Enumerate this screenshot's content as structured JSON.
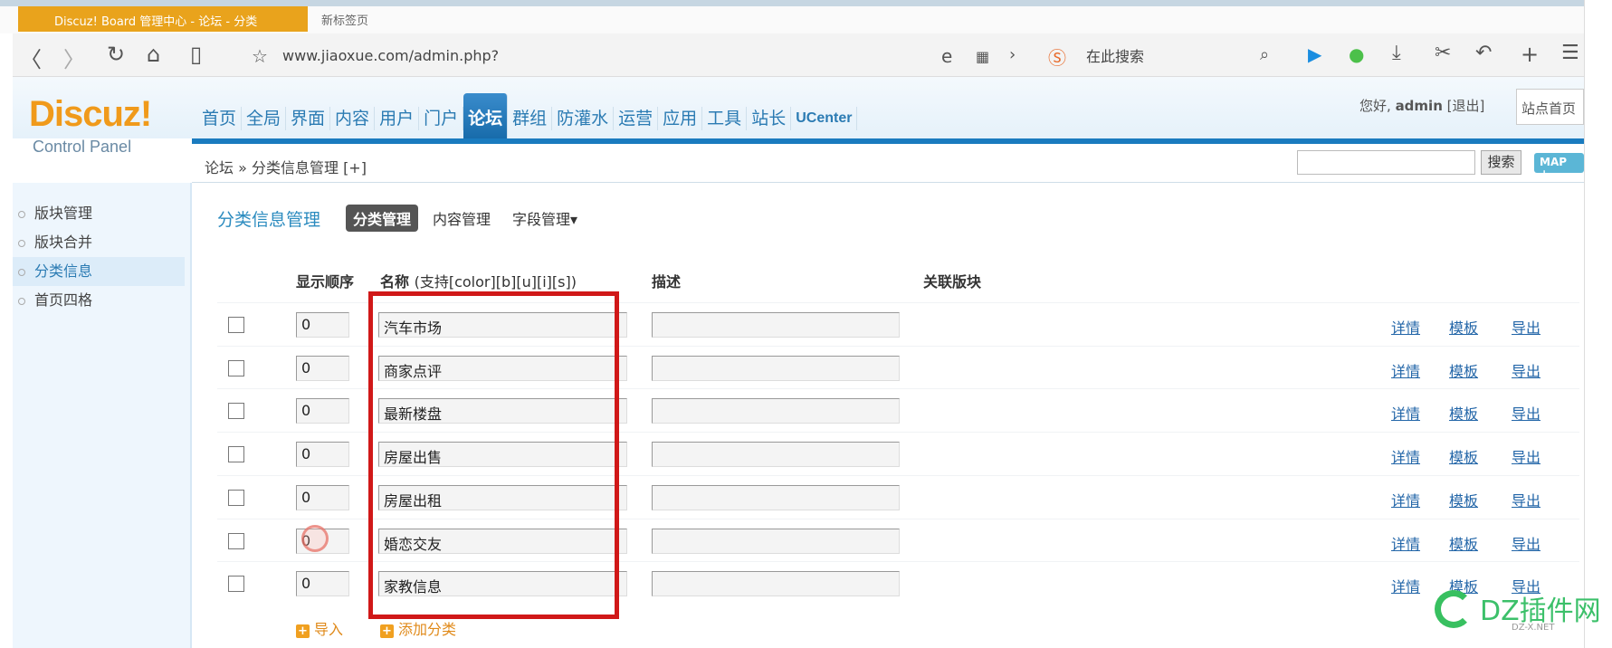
{
  "browser": {
    "active_tab": "Discuz! Board 管理中心 - 论坛 - 分类",
    "second_tab": "新标签页",
    "url": "www.jiaoxue.com/admin.php?",
    "search_placeholder": "在此搜索",
    "icons": [
      "back-icon",
      "forward-icon",
      "reload-icon",
      "home-icon",
      "reader-icon",
      "star-icon",
      "ie-icon",
      "qr-icon",
      "sogou-icon",
      "search-icon",
      "play-icon",
      "wechat-icon",
      "download-icon",
      "cut-icon",
      "undo-icon",
      "new-tab-icon",
      "menu-icon"
    ]
  },
  "header": {
    "logo": "Discuz!",
    "logo_sub": "Control Panel",
    "nav": [
      "首页",
      "全局",
      "界面",
      "内容",
      "用户",
      "门户",
      "论坛",
      "群组",
      "防灌水",
      "运营",
      "应用",
      "工具",
      "站长",
      "UCenter"
    ],
    "active_nav": "论坛",
    "greeting": "您好,",
    "username": "admin",
    "logout": "[退出]",
    "site_home": "站点首页"
  },
  "breadcrumb": {
    "text": "论坛 » 分类信息管理",
    "add": "[+]",
    "search_button": "搜索",
    "map_button": "MAP ↓"
  },
  "sidebar": {
    "items": [
      {
        "label": "版块管理"
      },
      {
        "label": "版块合并"
      },
      {
        "label": "分类信息",
        "active": true
      },
      {
        "label": "首页四格"
      }
    ]
  },
  "content": {
    "title": "分类信息管理",
    "tabs": [
      "分类管理",
      "内容管理",
      "字段管理▾"
    ],
    "columns": {
      "order": "显示顺序",
      "name": "名称",
      "name_hint": "(支持[color][b][u][i][s])",
      "desc": "描述",
      "forums": "关联版块"
    },
    "rows": [
      {
        "order": "0",
        "name": "汽车市场",
        "desc": ""
      },
      {
        "order": "0",
        "name": "商家点评",
        "desc": ""
      },
      {
        "order": "0",
        "name": "最新楼盘",
        "desc": ""
      },
      {
        "order": "0",
        "name": "房屋出售",
        "desc": ""
      },
      {
        "order": "0",
        "name": "房屋出租",
        "desc": ""
      },
      {
        "order": "0",
        "name": "婚恋交友",
        "desc": ""
      },
      {
        "order": "0",
        "name": "家教信息",
        "desc": ""
      }
    ],
    "row_links": {
      "detail": "详情",
      "template": "模板",
      "export": "导出"
    },
    "import": "导入",
    "add_category": "添加分类"
  },
  "watermark": {
    "text": "DZ插件网",
    "sub": "DZ-X.NET"
  },
  "colors": {
    "accent": "#1a7bbf",
    "logo": "#f09a1b",
    "highlight_box": "#d01818",
    "link": "#2366a8",
    "add_link": "#e08a1a"
  }
}
